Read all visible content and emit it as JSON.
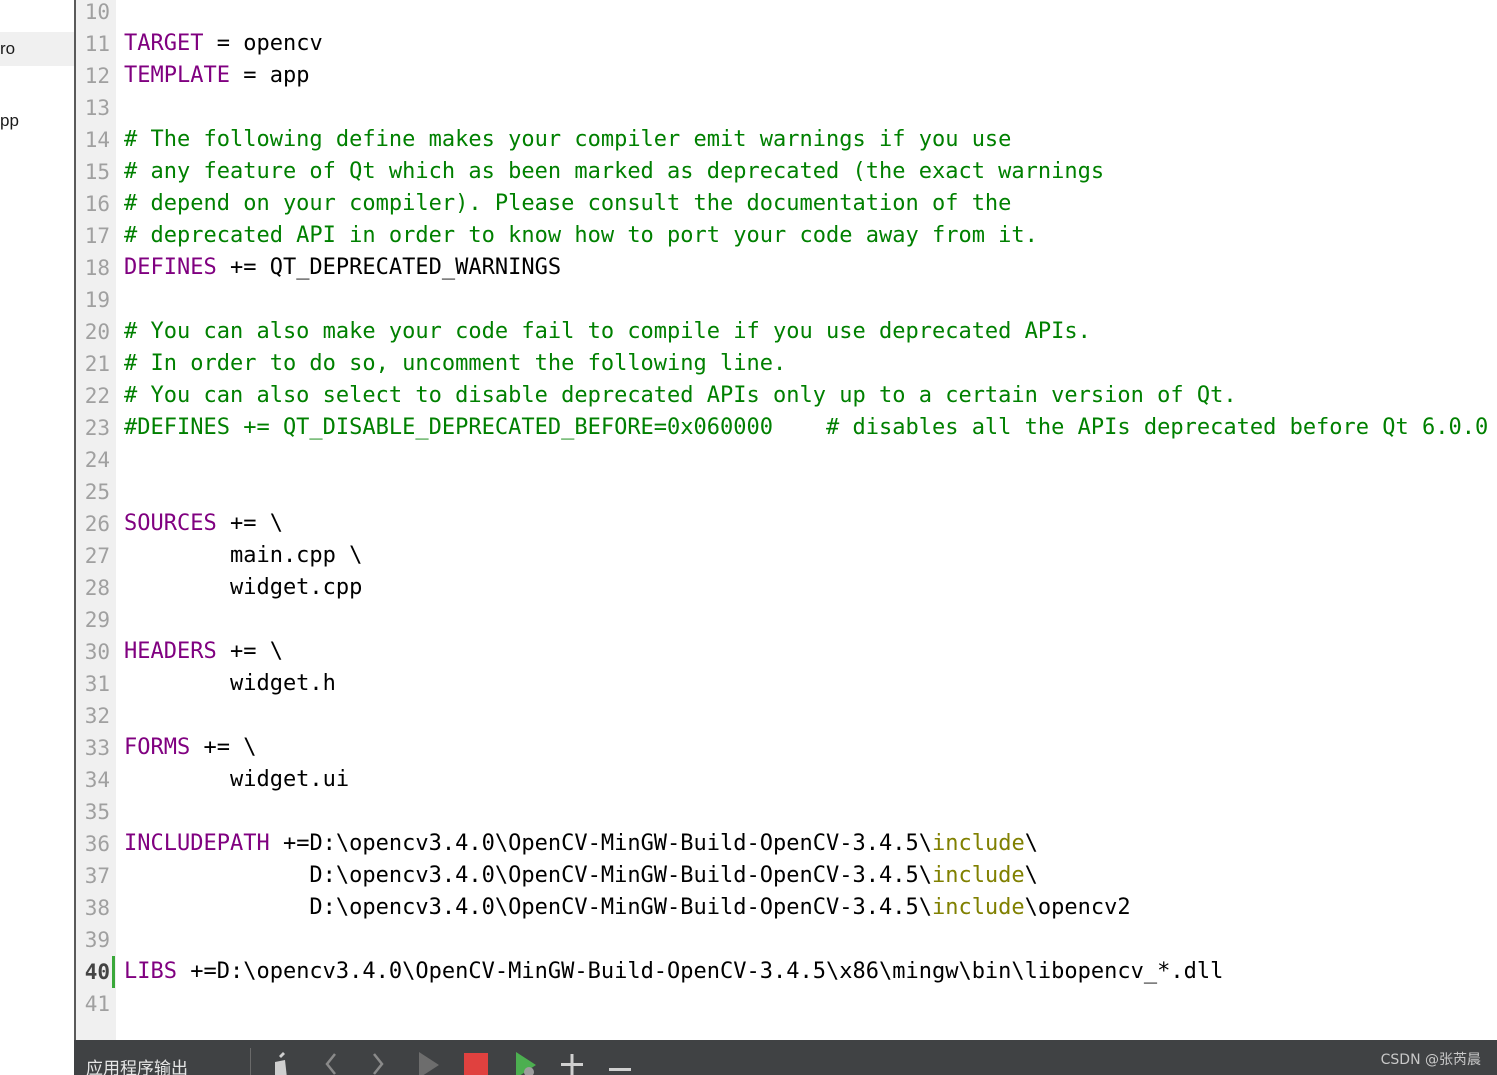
{
  "sidebar": {
    "items": [
      {
        "label": "ro",
        "selected": true
      },
      {
        "label": "pp",
        "selected": false
      }
    ]
  },
  "editor": {
    "current_line": 40,
    "lines": [
      {
        "num": "10",
        "segs": []
      },
      {
        "num": "11",
        "segs": [
          {
            "t": "TARGET",
            "c": "kw"
          },
          {
            "t": " = opencv",
            "c": ""
          }
        ]
      },
      {
        "num": "12",
        "segs": [
          {
            "t": "TEMPLATE",
            "c": "kw"
          },
          {
            "t": " = app",
            "c": ""
          }
        ]
      },
      {
        "num": "13",
        "segs": []
      },
      {
        "num": "14",
        "segs": [
          {
            "t": "# The following define makes your compiler emit warnings if you use",
            "c": "cm"
          }
        ]
      },
      {
        "num": "15",
        "segs": [
          {
            "t": "# any feature of Qt which as been marked as deprecated (the exact warnings",
            "c": "cm"
          }
        ]
      },
      {
        "num": "16",
        "segs": [
          {
            "t": "# depend on your compiler). Please consult the documentation of the",
            "c": "cm"
          }
        ]
      },
      {
        "num": "17",
        "segs": [
          {
            "t": "# deprecated API in order to know how to port your code away from it.",
            "c": "cm"
          }
        ]
      },
      {
        "num": "18",
        "segs": [
          {
            "t": "DEFINES",
            "c": "kw"
          },
          {
            "t": " += QT_DEPRECATED_WARNINGS",
            "c": ""
          }
        ]
      },
      {
        "num": "19",
        "segs": []
      },
      {
        "num": "20",
        "segs": [
          {
            "t": "# You can also make your code fail to compile if you use deprecated APIs.",
            "c": "cm"
          }
        ]
      },
      {
        "num": "21",
        "segs": [
          {
            "t": "# In order to do so, uncomment the following line.",
            "c": "cm"
          }
        ]
      },
      {
        "num": "22",
        "segs": [
          {
            "t": "# You can also select to disable deprecated APIs only up to a certain version of Qt.",
            "c": "cm"
          }
        ]
      },
      {
        "num": "23",
        "segs": [
          {
            "t": "#DEFINES += QT_DISABLE_DEPRECATED_BEFORE=0x060000    # disables all the APIs deprecated before Qt 6.0.0",
            "c": "cm"
          }
        ]
      },
      {
        "num": "24",
        "segs": []
      },
      {
        "num": "25",
        "segs": []
      },
      {
        "num": "26",
        "segs": [
          {
            "t": "SOURCES",
            "c": "kw"
          },
          {
            "t": " += \\",
            "c": ""
          }
        ]
      },
      {
        "num": "27",
        "segs": [
          {
            "t": "        main.cpp \\",
            "c": ""
          }
        ]
      },
      {
        "num": "28",
        "segs": [
          {
            "t": "        widget.cpp",
            "c": ""
          }
        ]
      },
      {
        "num": "29",
        "segs": []
      },
      {
        "num": "30",
        "segs": [
          {
            "t": "HEADERS",
            "c": "kw"
          },
          {
            "t": " += \\",
            "c": ""
          }
        ]
      },
      {
        "num": "31",
        "segs": [
          {
            "t": "        widget.h",
            "c": ""
          }
        ]
      },
      {
        "num": "32",
        "segs": []
      },
      {
        "num": "33",
        "segs": [
          {
            "t": "FORMS",
            "c": "kw"
          },
          {
            "t": " += \\",
            "c": ""
          }
        ]
      },
      {
        "num": "34",
        "segs": [
          {
            "t": "        widget.ui",
            "c": ""
          }
        ]
      },
      {
        "num": "35",
        "segs": []
      },
      {
        "num": "36",
        "segs": [
          {
            "t": "INCLUDEPATH",
            "c": "kw"
          },
          {
            "t": " +=D:\\opencv3.4.0\\OpenCV-MinGW-Build-OpenCV-3.4.5\\",
            "c": ""
          },
          {
            "t": "include",
            "c": "fn"
          },
          {
            "t": "\\",
            "c": ""
          }
        ]
      },
      {
        "num": "37",
        "segs": [
          {
            "t": "              D:\\opencv3.4.0\\OpenCV-MinGW-Build-OpenCV-3.4.5\\",
            "c": ""
          },
          {
            "t": "include",
            "c": "fn"
          },
          {
            "t": "\\",
            "c": ""
          }
        ]
      },
      {
        "num": "38",
        "segs": [
          {
            "t": "              D:\\opencv3.4.0\\OpenCV-MinGW-Build-OpenCV-3.4.5\\",
            "c": ""
          },
          {
            "t": "include",
            "c": "fn"
          },
          {
            "t": "\\opencv2",
            "c": ""
          }
        ]
      },
      {
        "num": "39",
        "segs": []
      },
      {
        "num": "40",
        "segs": [
          {
            "t": "LIBS",
            "c": "kw"
          },
          {
            "t": " +=D:\\opencv3.4.0\\OpenCV-MinGW-Build-OpenCV-3.4.5\\x86\\mingw\\bin\\libopencv_*.dll",
            "c": ""
          }
        ]
      },
      {
        "num": "41",
        "segs": []
      }
    ]
  },
  "bottom_bar": {
    "output_label": "应用程序输出",
    "icons": [
      "clear-icon",
      "prev-icon",
      "next-icon",
      "run-icon",
      "stop-icon",
      "debug-run-icon",
      "zoom-in-icon",
      "zoom-out-icon"
    ]
  },
  "watermark": "CSDN @张芮晨",
  "colors": {
    "keyword": "#800080",
    "comment": "#008000",
    "function": "#808000",
    "bar_bg": "#404244",
    "current_line_marker": "#3aa83a"
  }
}
